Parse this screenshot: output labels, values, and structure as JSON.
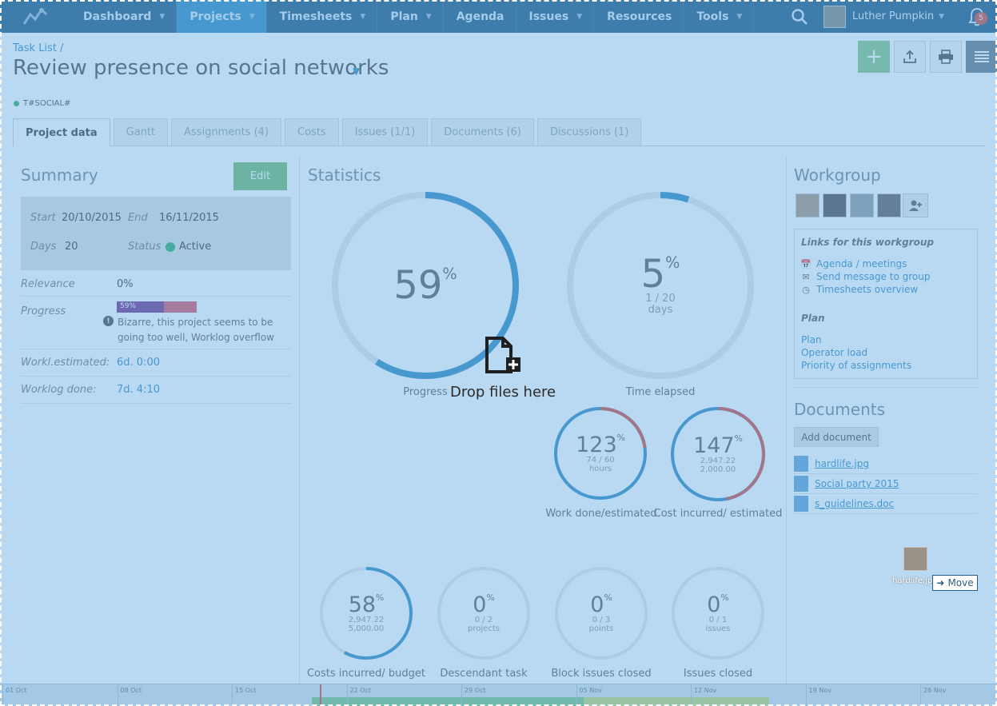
{
  "nav": {
    "items": [
      {
        "label": "Dashboard"
      },
      {
        "label": "Projects"
      },
      {
        "label": "Timesheets"
      },
      {
        "label": "Plan"
      },
      {
        "label": "Agenda"
      },
      {
        "label": "Issues"
      },
      {
        "label": "Resources"
      },
      {
        "label": "Tools"
      }
    ],
    "user_name": "Luther Pumpkin",
    "notification_count": "5"
  },
  "header": {
    "breadcrumb": "Task List /",
    "title": "Review presence on social networks",
    "tag": "T#SOCIAL#"
  },
  "tabs": [
    {
      "label": "Project data"
    },
    {
      "label": "Gantt"
    },
    {
      "label": "Assignments (4)"
    },
    {
      "label": "Costs"
    },
    {
      "label": "Issues (1/1)"
    },
    {
      "label": "Documents (6)"
    },
    {
      "label": "Discussions (1)"
    }
  ],
  "summary": {
    "heading": "Summary",
    "edit_label": "Edit",
    "start_label": "Start",
    "start_value": "20/10/2015",
    "end_label": "End",
    "end_value": "16/11/2015",
    "days_label": "Days",
    "days_value": "20",
    "status_label": "Status",
    "status_value": "Active",
    "relevance_label": "Relevance",
    "relevance_value": "0%",
    "progress_label": "Progress",
    "progress_value": "59%",
    "progress_fraction": 0.59,
    "progress_warning": "Bizarre, this project seems to be going too well, Worklog overflow",
    "worklog_estimated_label": "Workl.estimated:",
    "worklog_estimated_value": "6d. 0:00",
    "worklog_done_label": "Worklog done:",
    "worklog_done_value": "7d. 4:10"
  },
  "statistics": {
    "heading": "Statistics",
    "gauges": [
      {
        "id": "progress",
        "value": "59",
        "unit": "%",
        "sub1": "",
        "sub2": "",
        "label": "Progress",
        "fraction": 0.59,
        "color": "#3d8fc4"
      },
      {
        "id": "time",
        "value": "5",
        "unit": "%",
        "sub1": "1 / 20",
        "sub2": "days",
        "label": "Time elapsed",
        "fraction": 0.05,
        "color": "#3d8fc4"
      },
      {
        "id": "work",
        "value": "123",
        "unit": "%",
        "sub1": "74 / 60",
        "sub2": "hours",
        "label": "Work done/estimated",
        "fraction": 1.23,
        "color": "#3d8fc4"
      },
      {
        "id": "cost",
        "value": "147",
        "unit": "%",
        "sub1": "2,947.22",
        "sub2": "2,000.00",
        "label": "Cost incurred/ estimated",
        "fraction": 1.47,
        "color": "#3d8fc4"
      },
      {
        "id": "budget",
        "value": "58",
        "unit": "%",
        "sub1": "2,947.22",
        "sub2": "5,000.00",
        "label": "Costs incurred/ budget",
        "fraction": 0.58,
        "color": "#3d8fc4"
      },
      {
        "id": "descendant",
        "value": "0",
        "unit": "%",
        "sub1": "0 / 2",
        "sub2": "projects",
        "label": "Descendant task",
        "fraction": 0,
        "color": "#3d8fc4"
      },
      {
        "id": "block",
        "value": "0",
        "unit": "%",
        "sub1": "0 / 3",
        "sub2": "points",
        "label": "Block issues closed",
        "fraction": 0,
        "color": "#3d8fc4"
      },
      {
        "id": "issues",
        "value": "0",
        "unit": "%",
        "sub1": "0 / 1",
        "sub2": "issues",
        "label": "Issues closed",
        "fraction": 0,
        "color": "#3d8fc4"
      }
    ]
  },
  "workgroup": {
    "heading": "Workgroup",
    "links_title": "Links for this workgroup",
    "links": [
      {
        "label": "Agenda / meetings",
        "icon": "calendar-icon"
      },
      {
        "label": "Send message to group",
        "icon": "envelope-icon"
      },
      {
        "label": "Timesheets overview",
        "icon": "clock-icon"
      }
    ],
    "plan_title": "Plan",
    "plan_links": [
      {
        "label": "Plan"
      },
      {
        "label": "Operator load"
      },
      {
        "label": "Priority of assignments"
      }
    ]
  },
  "documents": {
    "heading": "Documents",
    "add_label": "Add document",
    "items": [
      {
        "name": "hardlife.jpg"
      },
      {
        "name": "Social party 2015"
      },
      {
        "name": "s_guidelines.doc"
      }
    ]
  },
  "timeline": {
    "ticks": [
      "01 Oct",
      "08 Oct",
      "15 Oct",
      "22 Oct",
      "29 Oct",
      "05 Nov",
      "12 Nov",
      "19 Nov",
      "26 Nov"
    ]
  },
  "overlay": {
    "drop_text": "Drop files here",
    "drag_file_name": "hardlife.jpg",
    "move_label": "Move"
  },
  "colors": {
    "nav_bg": "#2b5f86",
    "accent": "#3d8fc4",
    "overrun": "#d9534f",
    "ok": "#39b36f",
    "overlay": "#59a5e0"
  }
}
